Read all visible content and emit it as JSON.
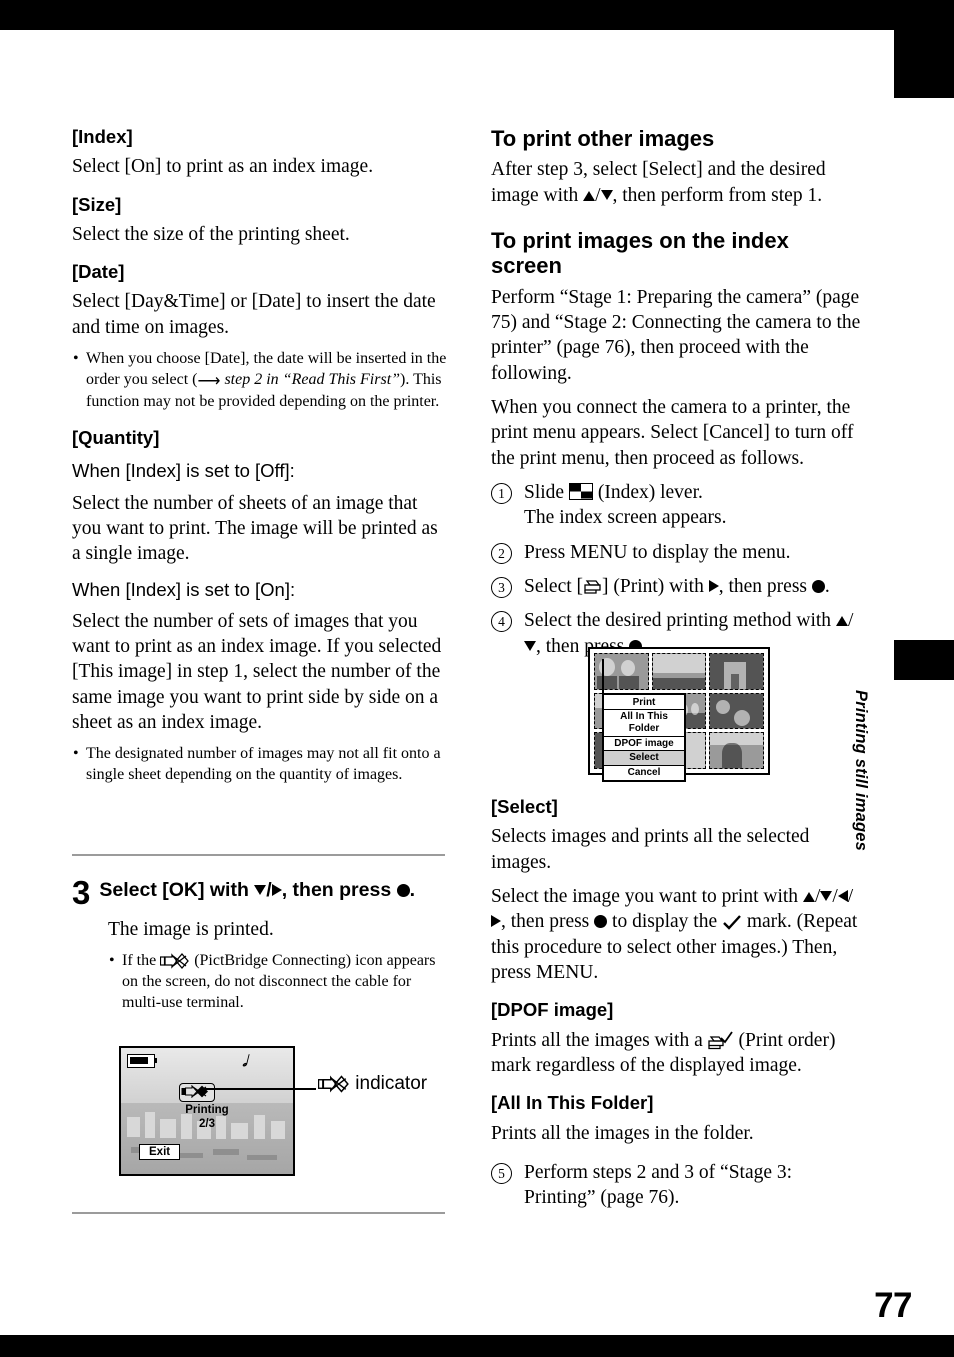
{
  "page": {
    "number": "77",
    "side_tab_label": "Printing still images"
  },
  "left_column": {
    "sections": [
      {
        "heading": "[Index]",
        "body": [
          "Select [On] to print as an index image."
        ]
      },
      {
        "heading": "[Size]",
        "body": [
          "Select the size of the printing sheet."
        ]
      },
      {
        "heading": "[Date]",
        "body": [
          "Select [Day&Time] or [Date] to insert the date and time on images."
        ]
      }
    ],
    "date_note_a": "When you choose [Date], the date will be inserted in the order you select (",
    "date_note_italic": "step 2 in “Read This First”",
    "date_note_b": "). This function may not be provided depending on the printer.",
    "quantity": {
      "heading": "[Quantity]",
      "cond_off": "When [Index] is set to [Off]:",
      "body_off": "Select the number of sheets of an image that you want to print. The image will be printed as a single image.",
      "cond_on": "When [Index] is set to [On]:",
      "body_on": "Select the number of sets of images that you want to print as an index image. If you selected [This image] in step 1, select the number of the same image you want to print side by side on a sheet as an index image.",
      "note": "The designated number of images may not all fit onto a single sheet depending on the quantity of images."
    },
    "step3": {
      "number": "3",
      "title_a": "Select [OK] with ",
      "title_b": ", then press ",
      "title_c": ".",
      "result": "The image is printed.",
      "note_a": "If the ",
      "note_b": " (PictBridge Connecting) icon appears on the screen, do not disconnect the cable for multi-use terminal."
    },
    "figure_lcd": {
      "status": "Printing",
      "count": "2/3",
      "exit_label": "Exit",
      "callout_label": "indicator",
      "callout_icon": "pictbridge-connecting-icon"
    }
  },
  "right_column": {
    "other_images": {
      "heading": "To print other images",
      "body_a": "After step 3, select [Select] and the desired image with ",
      "body_b": ", then perform from step 1."
    },
    "index_screen": {
      "heading": "To print images on the index screen",
      "intro": "Perform “Stage 1: Preparing the camera” (page 75) and “Stage 2: Connecting the camera to the printer” (page 76), then proceed with the following.",
      "intro2": "When you connect the camera to a printer, the print menu appears. Select [Cancel] to turn off the print menu, then proceed as follows.",
      "steps": [
        {
          "num": "1",
          "text_a": "Slide ",
          "text_b": " (Index) lever.",
          "text_c": "The index screen appears."
        },
        {
          "num": "2",
          "text_a": "Press MENU to display the menu.",
          "text_b": "",
          "text_c": ""
        },
        {
          "num": "3",
          "text_a": "Select [",
          "text_b": "] (Print) with ",
          "text_c": ", then press ",
          "text_d": "."
        },
        {
          "num": "4",
          "text_a": "Select the desired printing method with ",
          "text_b": ", then press ",
          "text_c": "."
        }
      ],
      "final_step": {
        "num": "5",
        "text": "Perform steps 2 and 3 of “Stage 3: Printing” (page 76)."
      }
    },
    "figure_index": {
      "menu_title": "Print",
      "menu_items": [
        "All In This Folder",
        "DPOF image",
        "Select",
        "Cancel"
      ],
      "selected_item": "Select"
    },
    "select_section": {
      "heading": "[Select]",
      "body1": "Selects images and prints all the selected images.",
      "body2_a": "Select the image you want to print with ",
      "body2_b": ", then press ",
      "body2_c": " to display the ",
      "body2_d": " mark. (Repeat this procedure to select other images.) Then, press MENU."
    },
    "dpof_section": {
      "heading": "[DPOF image]",
      "body_a": "Prints all the images with a ",
      "body_b": " (Print order) mark regardless of the displayed image."
    },
    "folder_section": {
      "heading": "[All In This Folder]",
      "body": "Prints all the images in the folder."
    }
  }
}
